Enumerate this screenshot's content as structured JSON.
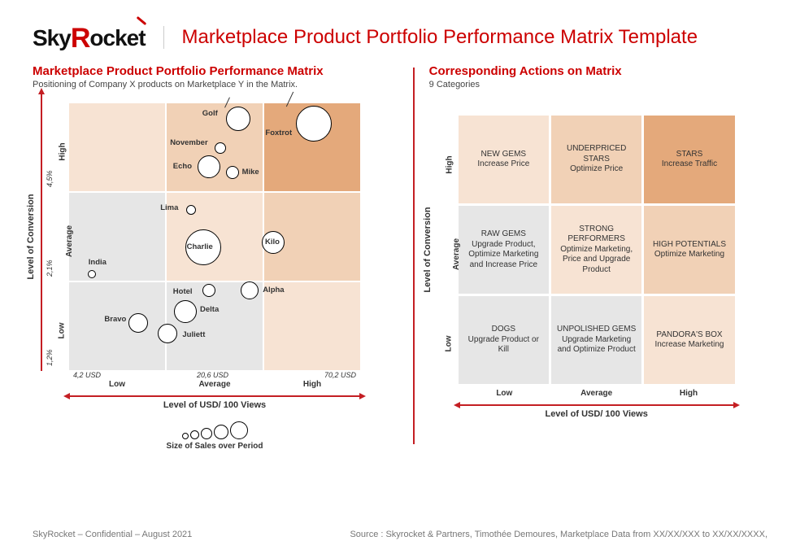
{
  "header": {
    "logo_text_pre": "Sky",
    "logo_text_r": "R",
    "logo_text_post": "ocket",
    "page_title": "Marketplace Product Portfolio Performance Matrix Template"
  },
  "left": {
    "title": "Marketplace Product Portfolio Performance Matrix",
    "subtitle": "Positioning of Company X products on Marketplace Y in the Matrix.",
    "y_axis_label": "Level of Conversion",
    "y_ticks": [
      "1,2%",
      "2,1%",
      "4,5%"
    ],
    "y_cats": [
      "Low",
      "Average",
      "High"
    ],
    "x_axis_label": "Level of USD/ 100 Views",
    "x_ticks": [
      "4,2 USD",
      "20,6 USD",
      "70,2 USD"
    ],
    "x_cats": [
      "Low",
      "Average",
      "High"
    ],
    "legend_label": "Size of Sales over Period"
  },
  "right": {
    "title": "Corresponding Actions on Matrix",
    "subtitle": "9 Categories",
    "y_axis_label": "Level of Conversion",
    "y_cats": [
      "Low",
      "Average",
      "High"
    ],
    "x_axis_label": "Level of USD/ 100 Views",
    "x_cats": [
      "Low",
      "Average",
      "High"
    ],
    "actions": [
      {
        "name": "NEW GEMS",
        "action": "Increase Price"
      },
      {
        "name": "UNDERPRICED STARS",
        "action": "Optimize Price"
      },
      {
        "name": "STARS",
        "action": "Increase Traffic"
      },
      {
        "name": "RAW GEMS",
        "action": "Upgrade Product, Optimize Marketing and Increase Price"
      },
      {
        "name": "STRONG PERFORMERS",
        "action": "Optimize Marketing, Price and Upgrade Product"
      },
      {
        "name": "HIGH POTENTIALS",
        "action": "Optimize Marketing"
      },
      {
        "name": "DOGS",
        "action": "Upgrade Product or Kill"
      },
      {
        "name": "UNPOLISHED GEMS",
        "action": "Upgrade Marketing and Optimize Product"
      },
      {
        "name": "PANDORA'S BOX",
        "action": "Increase Marketing"
      }
    ]
  },
  "footer": {
    "left": "SkyRocket – Confidential – August 2021",
    "right": "Source : Skyrocket & Partners, Timothée Demoures, Marketplace Data from XX/XX/XXX to XX/XX/XXXX,"
  },
  "chart_data": {
    "type": "scatter",
    "title": "Marketplace Product Portfolio Performance Matrix",
    "xlabel": "Level of USD/ 100 Views",
    "ylabel": "Level of Conversion",
    "x_scale_breaks": [
      4.2,
      20.6,
      70.2
    ],
    "y_scale_breaks": [
      1.2,
      2.1,
      4.5
    ],
    "x_unit": "USD / 100 views",
    "y_unit": "Conversion %",
    "size_encodes": "Size of Sales over Period",
    "grid_categories": {
      "x": [
        "Low",
        "Average",
        "High"
      ],
      "y": [
        "Low",
        "Average",
        "High"
      ]
    },
    "points": [
      {
        "name": "India",
        "x_pct": 8,
        "y_pct": 36,
        "size": 10
      },
      {
        "name": "Bravo",
        "x_pct": 24,
        "y_pct": 18,
        "size": 24
      },
      {
        "name": "Juliett",
        "x_pct": 34,
        "y_pct": 14,
        "size": 24
      },
      {
        "name": "Delta",
        "x_pct": 40,
        "y_pct": 22,
        "size": 28
      },
      {
        "name": "Hotel",
        "x_pct": 48,
        "y_pct": 30,
        "size": 16
      },
      {
        "name": "Alpha",
        "x_pct": 62,
        "y_pct": 30,
        "size": 22
      },
      {
        "name": "Charlie",
        "x_pct": 46,
        "y_pct": 46,
        "size": 44
      },
      {
        "name": "Kilo",
        "x_pct": 70,
        "y_pct": 48,
        "size": 28
      },
      {
        "name": "Lima",
        "x_pct": 42,
        "y_pct": 60,
        "size": 12
      },
      {
        "name": "Echo",
        "x_pct": 48,
        "y_pct": 76,
        "size": 28
      },
      {
        "name": "Mike",
        "x_pct": 56,
        "y_pct": 74,
        "size": 16
      },
      {
        "name": "November",
        "x_pct": 52,
        "y_pct": 83,
        "size": 14
      },
      {
        "name": "Golf",
        "x_pct": 58,
        "y_pct": 94,
        "size": 30
      },
      {
        "name": "Foxtrot",
        "x_pct": 84,
        "y_pct": 92,
        "size": 44
      }
    ],
    "label_offsets": {
      "India": {
        "dx": -4,
        "dy": -14,
        "lead": false
      },
      "Bravo": {
        "dx": -42,
        "dy": -4,
        "lead": false
      },
      "Juliett": {
        "dx": 18,
        "dy": 2,
        "lead": false
      },
      "Delta": {
        "dx": 18,
        "dy": -2,
        "lead": false
      },
      "Hotel": {
        "dx": -44,
        "dy": 2,
        "lead": false
      },
      "Alpha": {
        "dx": 16,
        "dy": 0,
        "lead": false
      },
      "Charlie": {
        "dx": -20,
        "dy": 0,
        "lead": false
      },
      "Kilo": {
        "dx": -10,
        "dy": 0,
        "lead": false
      },
      "Lima": {
        "dx": -38,
        "dy": -2,
        "lead": false
      },
      "Echo": {
        "dx": -44,
        "dy": 0,
        "lead": false
      },
      "Mike": {
        "dx": 12,
        "dy": 0,
        "lead": false
      },
      "November": {
        "dx": -62,
        "dy": -6,
        "lead": false
      },
      "Golf": {
        "dx": -44,
        "dy": -6,
        "lead": true,
        "lead_len": 14
      },
      "Foxtrot": {
        "dx": -60,
        "dy": 12,
        "lead": true,
        "lead_len": 20
      }
    }
  }
}
